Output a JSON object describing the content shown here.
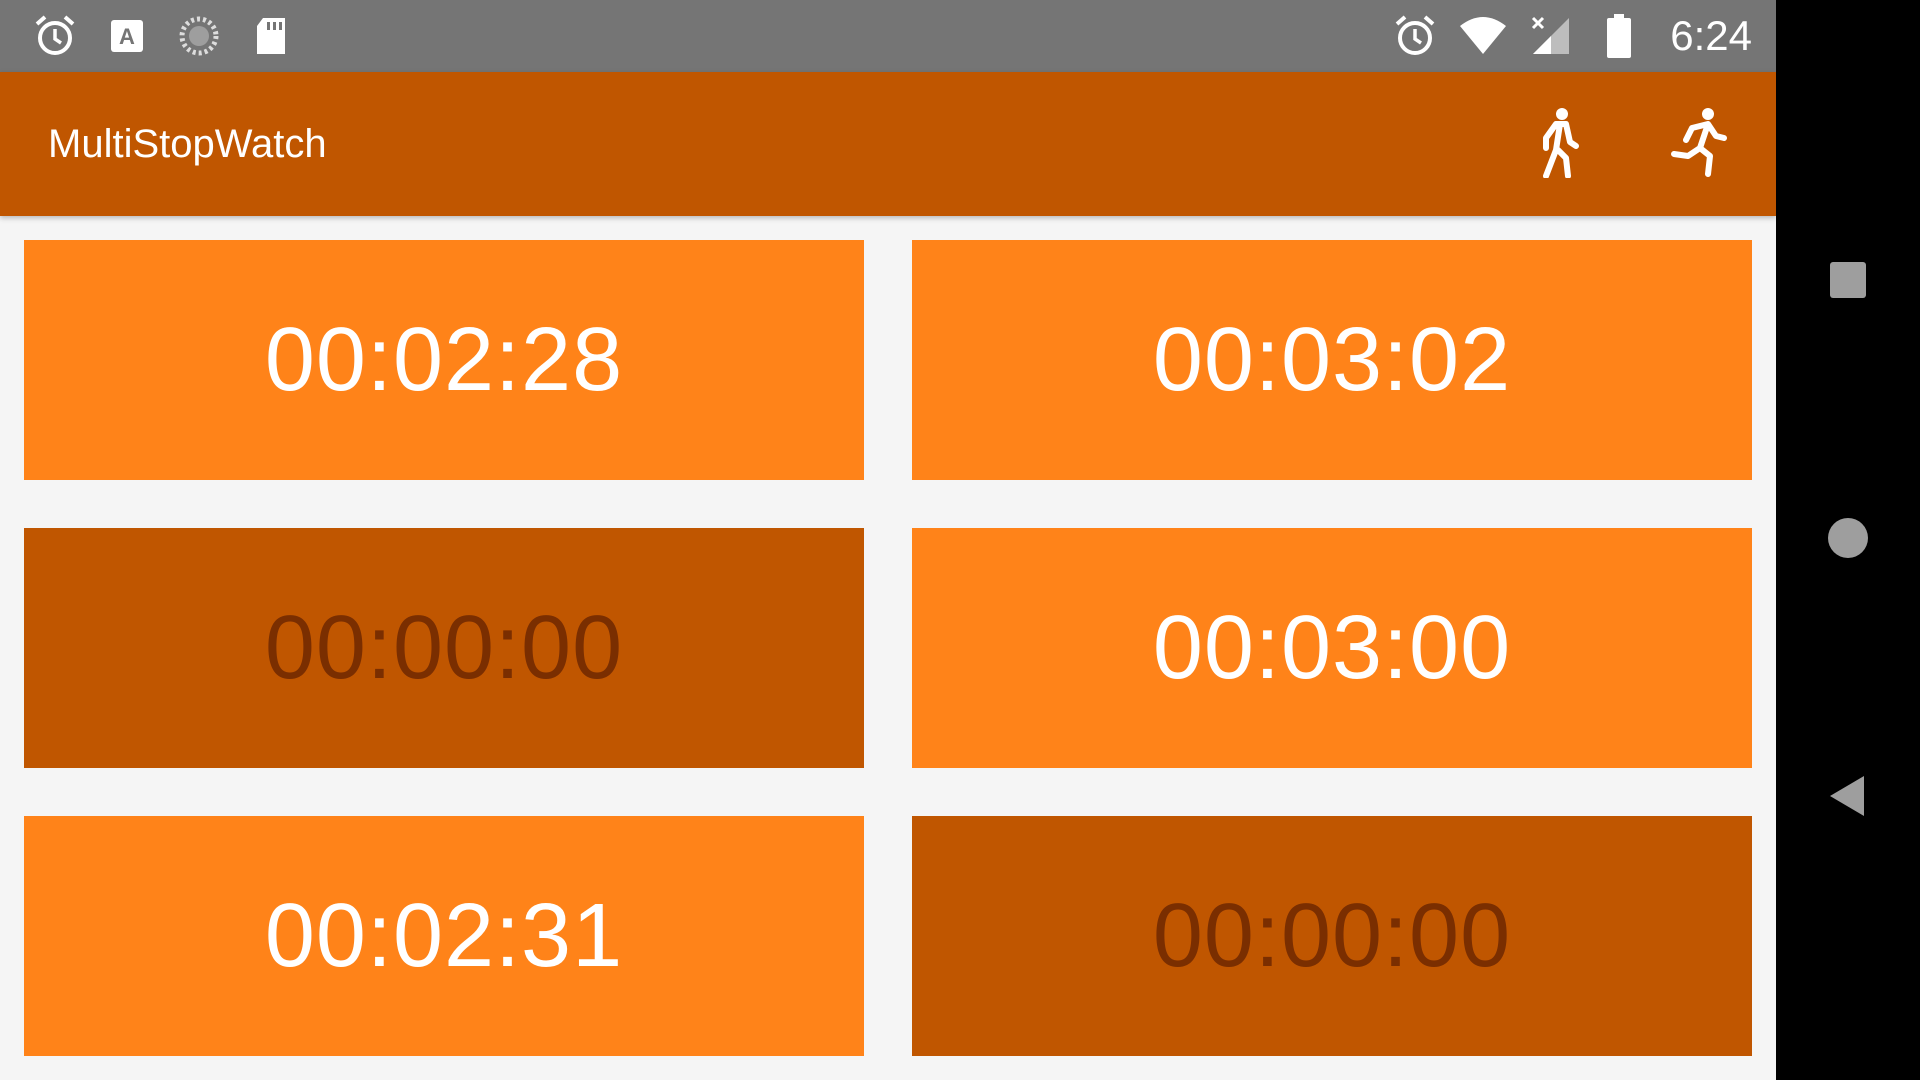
{
  "status_bar": {
    "time": "6:24",
    "left_icons": [
      "alarm-icon",
      "keyboard-a-icon",
      "sync-spinner-icon",
      "sd-card-icon"
    ],
    "right_icons": [
      "alarm-icon",
      "wifi-icon",
      "no-signal-icon",
      "battery-icon"
    ]
  },
  "app_bar": {
    "title": "MultiStopWatch",
    "actions": [
      "walk-icon",
      "run-icon"
    ]
  },
  "stopwatches": [
    {
      "time": "00:02:28",
      "state": "running"
    },
    {
      "time": "00:03:02",
      "state": "running"
    },
    {
      "time": "00:00:00",
      "state": "stopped"
    },
    {
      "time": "00:03:00",
      "state": "running"
    },
    {
      "time": "00:02:31",
      "state": "running"
    },
    {
      "time": "00:00:00",
      "state": "stopped"
    }
  ],
  "colors": {
    "app_bar": "#c05600",
    "tile_running": "#ff8319",
    "tile_stopped": "#c05600",
    "text_stopped": "#7a2e00",
    "status_bar": "#757575",
    "background": "#f5f5f5"
  },
  "nav_bar": {
    "buttons": [
      "recents-square-icon",
      "home-circle-icon",
      "back-triangle-icon"
    ]
  }
}
